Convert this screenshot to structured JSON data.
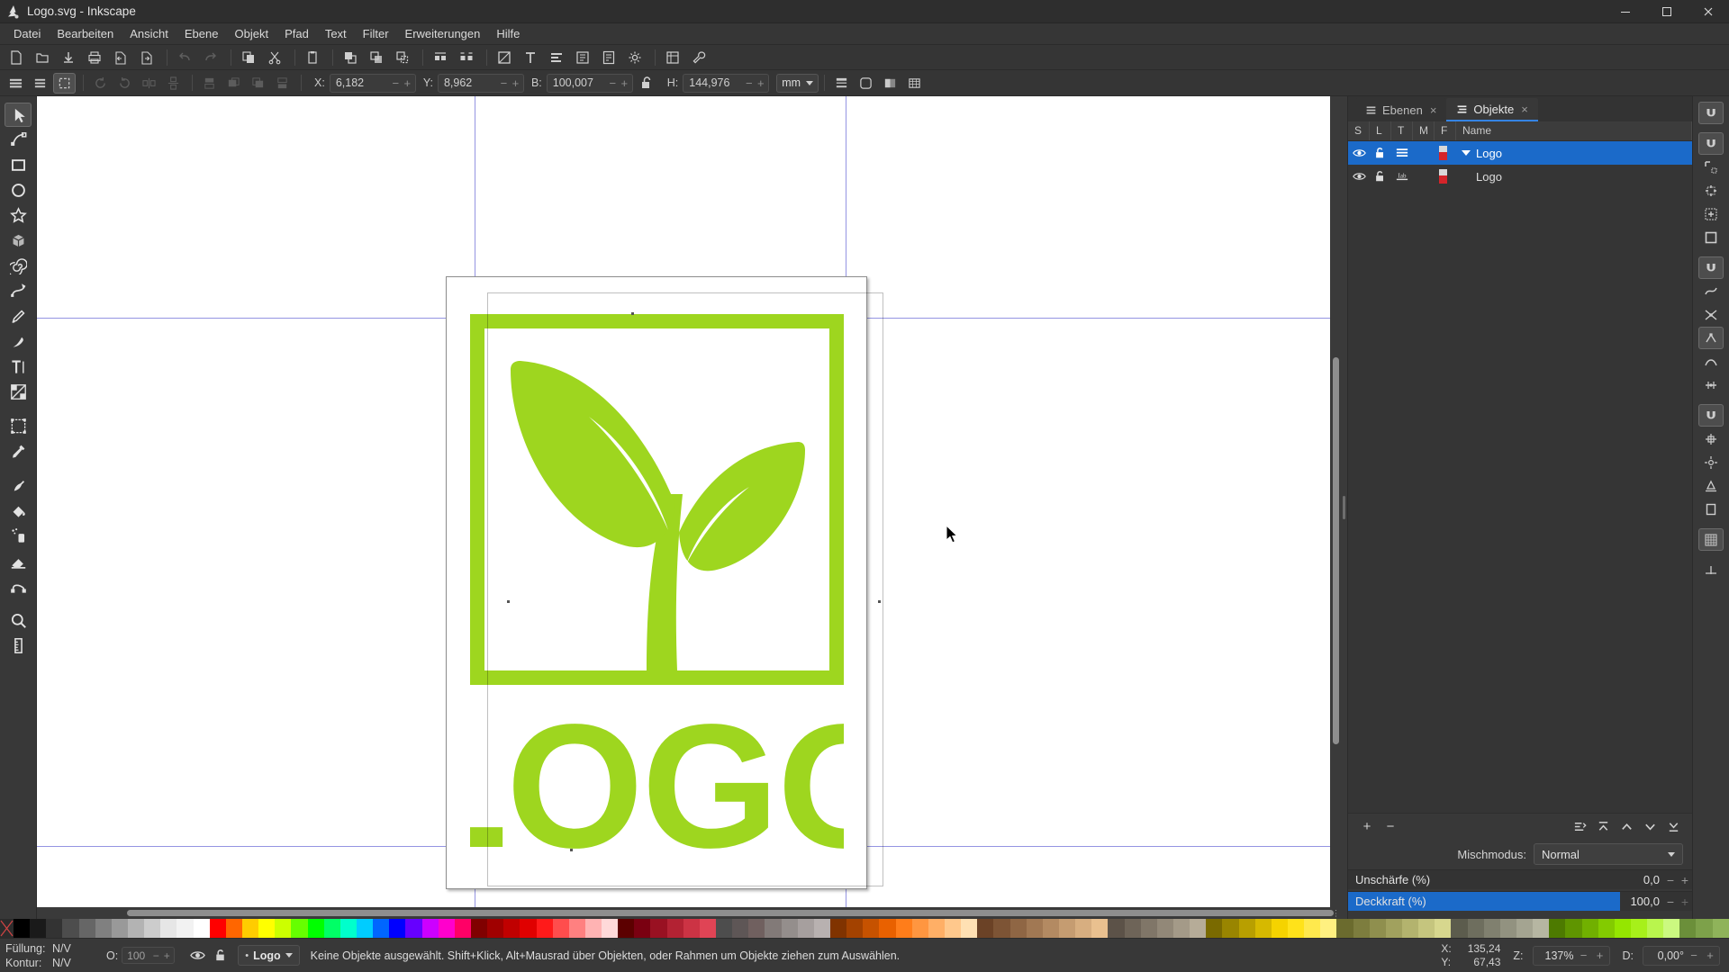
{
  "window": {
    "title": "Logo.svg - Inkscape",
    "app_icon": "inkscape-icon",
    "minimize": "─",
    "maximize": "□",
    "close": "✕"
  },
  "menubar": {
    "items": [
      {
        "label": "Datei",
        "name": "menu-datei"
      },
      {
        "label": "Bearbeiten",
        "name": "menu-bearbeiten"
      },
      {
        "label": "Ansicht",
        "name": "menu-ansicht"
      },
      {
        "label": "Ebene",
        "name": "menu-ebene"
      },
      {
        "label": "Objekt",
        "name": "menu-objekt"
      },
      {
        "label": "Pfad",
        "name": "menu-pfad"
      },
      {
        "label": "Text",
        "name": "menu-text"
      },
      {
        "label": "Filter",
        "name": "menu-filter"
      },
      {
        "label": "Erweiterungen",
        "name": "menu-erweiterungen"
      },
      {
        "label": "Hilfe",
        "name": "menu-hilfe"
      }
    ]
  },
  "commandbar": {
    "buttons": [
      {
        "name": "new-document-icon",
        "glyph": "🗋",
        "disabled": false
      },
      {
        "name": "open-document-icon",
        "glyph": "📂",
        "disabled": false
      },
      {
        "name": "save-document-icon",
        "glyph": "⬇",
        "disabled": false
      },
      {
        "name": "print-document-icon",
        "glyph": "🖶",
        "disabled": false
      },
      {
        "name": "import-icon",
        "glyph": "←",
        "disabled": false
      },
      {
        "name": "export-icon",
        "glyph": "→",
        "disabled": false
      },
      {
        "name": "undo-icon",
        "glyph": "↶",
        "disabled": true
      },
      {
        "name": "redo-icon",
        "glyph": "↷",
        "disabled": true
      },
      {
        "name": "copy-icon",
        "glyph": "⧉",
        "disabled": false
      },
      {
        "name": "cut-icon",
        "glyph": "✂",
        "disabled": false
      },
      {
        "name": "paste-icon",
        "glyph": "📋",
        "disabled": false
      },
      {
        "name": "duplicate-icon",
        "glyph": "❐",
        "disabled": false
      },
      {
        "name": "clone-icon",
        "glyph": "❑",
        "disabled": false
      },
      {
        "name": "unlink-clone-icon",
        "glyph": "❏",
        "disabled": false
      },
      {
        "name": "group-icon",
        "glyph": "❖",
        "disabled": false
      },
      {
        "name": "ungroup-icon",
        "glyph": "❇",
        "disabled": false
      },
      {
        "name": "fill-stroke-dialog-icon",
        "glyph": "◱",
        "disabled": false
      },
      {
        "name": "text-properties-icon",
        "glyph": "T",
        "disabled": false
      },
      {
        "name": "align-dialog-icon",
        "glyph": "☰",
        "disabled": false
      },
      {
        "name": "xml-editor-icon",
        "glyph": "▣",
        "disabled": false
      },
      {
        "name": "document-properties-icon",
        "glyph": "▤",
        "disabled": false
      },
      {
        "name": "preferences-icon",
        "glyph": "⚙",
        "disabled": false
      },
      {
        "name": "selectors-icon",
        "glyph": "▦",
        "disabled": false
      },
      {
        "name": "wrench-icon",
        "glyph": "🔧",
        "disabled": false
      }
    ]
  },
  "tooloptions": {
    "select_all_label": "select-all",
    "fields": [
      {
        "name": "x-field",
        "label": "X:",
        "value": "6,182"
      },
      {
        "name": "y-field",
        "label": "Y:",
        "value": "8,962"
      },
      {
        "name": "width-field",
        "label": "B:",
        "value": "100,007"
      },
      {
        "name": "height-field",
        "label": "H:",
        "value": "144,976"
      }
    ],
    "lock_ratio": "unlocked",
    "unit": "mm",
    "minus": "−",
    "plus": "+"
  },
  "toolbox": {
    "tools": [
      {
        "name": "selector-tool",
        "glyph": "selector",
        "active": true
      },
      {
        "name": "node-tool",
        "glyph": "node",
        "active": false
      },
      {
        "name": "rectangle-tool",
        "glyph": "rect",
        "active": false
      },
      {
        "name": "ellipse-tool",
        "glyph": "ellipse",
        "active": false
      },
      {
        "name": "star-tool",
        "glyph": "star",
        "active": false
      },
      {
        "name": "3dbox-tool",
        "glyph": "cube",
        "active": false
      },
      {
        "name": "spiral-tool",
        "glyph": "spiral",
        "active": false
      },
      {
        "name": "bezier-tool",
        "glyph": "bezier",
        "active": false
      },
      {
        "name": "pencil-tool",
        "glyph": "pencil",
        "active": false
      },
      {
        "name": "calligraphy-tool",
        "glyph": "calligraphy",
        "active": false
      },
      {
        "name": "text-tool",
        "glyph": "text",
        "active": false
      },
      {
        "name": "gradient-tool",
        "glyph": "gradient",
        "active": false
      },
      {
        "name": "mesh-tool",
        "glyph": "mesh",
        "active": false
      },
      {
        "name": "dropper-tool",
        "glyph": "dropper",
        "active": false
      },
      {
        "name": "tweak-tool",
        "glyph": "tweak",
        "active": false
      },
      {
        "name": "paintbucket-tool",
        "glyph": "bucket",
        "active": false
      },
      {
        "name": "spray-tool",
        "glyph": "spray",
        "active": false
      },
      {
        "name": "eraser-tool",
        "glyph": "eraser",
        "active": false
      },
      {
        "name": "connector-tool",
        "glyph": "connector",
        "active": false
      },
      {
        "name": "zoom-tool",
        "glyph": "zoom",
        "active": false
      },
      {
        "name": "measure-tool",
        "glyph": "measure",
        "active": false
      }
    ]
  },
  "canvas": {
    "document_name": "Logo.svg",
    "logo": {
      "color": "#9ed61f",
      "text": "LOGO",
      "description": "plant-sprout-in-square-frame-logo"
    },
    "guides_color": "#5a5ad2",
    "page_background": "#ffffff"
  },
  "dock": {
    "tabs": [
      {
        "label": "Ebenen",
        "name": "tab-ebenen",
        "active": false,
        "close": "×"
      },
      {
        "label": "Objekte",
        "name": "tab-objekte",
        "active": true,
        "close": "×"
      }
    ],
    "columns": [
      "S",
      "L",
      "T",
      "M",
      "F",
      "Name"
    ],
    "rows": [
      {
        "name": "Logo",
        "selected": true,
        "expander": true,
        "indent": 0,
        "visible_icon": "eye-icon",
        "lock_icon": "unlock-icon",
        "type_icon": "layer-icon",
        "fill_swatch": "#cf2a2a"
      },
      {
        "name": "Logo",
        "selected": false,
        "expander": false,
        "indent": 1,
        "visible_icon": "eye-icon",
        "lock_icon": "unlock-icon",
        "type_icon": "label-icon",
        "fill_swatch": "#cf2a2a"
      }
    ],
    "footer_buttons": [
      {
        "name": "add-object-button",
        "glyph": "+"
      },
      {
        "name": "remove-object-button",
        "glyph": "−"
      },
      {
        "name": "move-to-layer-button",
        "glyph": "⇥"
      },
      {
        "name": "raise-to-top-button",
        "glyph": "⤒"
      },
      {
        "name": "raise-button",
        "glyph": "⌃"
      },
      {
        "name": "lower-button",
        "glyph": "⌄"
      },
      {
        "name": "lower-to-bottom-button",
        "glyph": "⤓"
      }
    ],
    "blend_mode_label": "Mischmodus:",
    "blend_mode_value": "Normal",
    "sliders": [
      {
        "label": "Unschärfe (%)",
        "value": "0,0",
        "fill_pct": 0,
        "name": "blur-slider"
      },
      {
        "label": "Deckkraft (%)",
        "value": "100,0",
        "fill_pct": 100,
        "name": "opacity-slider"
      }
    ]
  },
  "snapbar": {
    "buttons": [
      {
        "name": "enable-snapping-toggle",
        "glyph": "magnet",
        "on": true
      },
      {
        "name": "snap-bounding-boxes-toggle",
        "glyph": "magnet",
        "on": true
      },
      {
        "name": "snap-bbox-corners-toggle",
        "glyph": "bbox-corner",
        "on": false
      },
      {
        "name": "snap-bbox-edge-midpoints-toggle",
        "glyph": "bbox-edge",
        "on": false
      },
      {
        "name": "snap-bbox-centers-toggle",
        "glyph": "bbox-center",
        "on": false
      },
      {
        "name": "snap-bbox-edges-toggle",
        "glyph": "bbox-edges",
        "on": false
      },
      {
        "name": "snap-nodes-paths-toggle",
        "glyph": "magnet",
        "on": true
      },
      {
        "name": "snap-paths-toggle",
        "glyph": "path",
        "on": false
      },
      {
        "name": "snap-path-intersections-toggle",
        "glyph": "intersection",
        "on": false
      },
      {
        "name": "snap-cusp-nodes-toggle",
        "glyph": "cusp",
        "on": true
      },
      {
        "name": "snap-smooth-nodes-toggle",
        "glyph": "smooth",
        "on": false
      },
      {
        "name": "snap-midpoints-toggle",
        "glyph": "midpoint",
        "on": false
      },
      {
        "name": "snap-others-toggle",
        "glyph": "magnet",
        "on": true
      },
      {
        "name": "snap-object-centers-toggle",
        "glyph": "obj-center",
        "on": false
      },
      {
        "name": "snap-rotation-centers-toggle",
        "glyph": "rot-center",
        "on": false
      },
      {
        "name": "snap-text-baselines-toggle",
        "glyph": "text-baseline",
        "on": false
      },
      {
        "name": "snap-page-border-toggle",
        "glyph": "page-border",
        "on": false
      },
      {
        "name": "snap-grid-toggle",
        "glyph": "grid",
        "on": true
      },
      {
        "name": "snap-guides-toggle",
        "glyph": "guide",
        "on": false
      }
    ]
  },
  "statusbar": {
    "fill_label": "Füllung:",
    "fill_value": "N/V",
    "stroke_label": "Kontur:",
    "stroke_value": "N/V",
    "opacity_label": "O:",
    "opacity_value": "100",
    "minus": "−",
    "plus": "+",
    "visibility_icon": "eye-icon",
    "lock_icon": "unlock-icon",
    "layer_name": "Logo",
    "message": "Keine Objekte ausgewählt. Shift+Klick, Alt+Mausrad über Objekten, oder Rahmen um Objekte ziehen zum Auswählen.",
    "pointer_x_label": "X:",
    "pointer_x": "135,24",
    "pointer_y_label": "Y:",
    "pointer_y": "67,43",
    "zoom_label": "Z:",
    "zoom_value": "137%",
    "rotation_label": "D:",
    "rotation_value": "0,00°"
  },
  "palette": {
    "none_swatch": "none",
    "colors": [
      "#000000",
      "#1a1a1a",
      "#333333",
      "#4d4d4d",
      "#666666",
      "#808080",
      "#999999",
      "#b3b3b3",
      "#cccccc",
      "#e6e6e6",
      "#f2f2f2",
      "#ffffff",
      "#ff0000",
      "#ff6600",
      "#ffcc00",
      "#ffff00",
      "#ccff00",
      "#66ff00",
      "#00ff00",
      "#00ff66",
      "#00ffcc",
      "#00ccff",
      "#0066ff",
      "#0000ff",
      "#6600ff",
      "#cc00ff",
      "#ff00cc",
      "#ff0066",
      "#800000",
      "#a00000",
      "#c00000",
      "#e00000",
      "#ff1a1a",
      "#ff4d4d",
      "#ff8080",
      "#ffb3b3",
      "#ffd9d9",
      "#5c0000",
      "#7a0011",
      "#991122",
      "#b32233",
      "#cc3344",
      "#e04455",
      "#4d4d4d",
      "#5e5656",
      "#70605f",
      "#827a78",
      "#948e8c",
      "#a69f9e",
      "#b8b1b0",
      "#803300",
      "#a34200",
      "#c65200",
      "#e96100",
      "#ff7d1a",
      "#ff9640",
      "#ffaf66",
      "#ffc88c",
      "#ffe0b3",
      "#6b4226",
      "#7d5435",
      "#8f6644",
      "#a17853",
      "#b38a62",
      "#c59c71",
      "#d7ae80",
      "#e9c08f",
      "#5c5248",
      "#6e6458",
      "#807668",
      "#928878",
      "#a49a88",
      "#b6ac98",
      "#7a6a00",
      "#998500",
      "#b89f00",
      "#d6b900",
      "#f5d300",
      "#ffe21a",
      "#ffe94d",
      "#fff080",
      "#6b6b2e",
      "#7d7d3e",
      "#8f8f4e",
      "#a1a15e",
      "#b3b36e",
      "#c5c57e",
      "#d7d78e",
      "#5c5c4d",
      "#6e6e5e",
      "#80806f",
      "#929280",
      "#a4a491",
      "#b6b6a2",
      "#4d7a00",
      "#5f9500",
      "#71b000",
      "#83cb00",
      "#95e600",
      "#a7f01a",
      "#b9f54d",
      "#cbf980",
      "#6b8f3a",
      "#7da14a",
      "#8fb35a"
    ]
  }
}
